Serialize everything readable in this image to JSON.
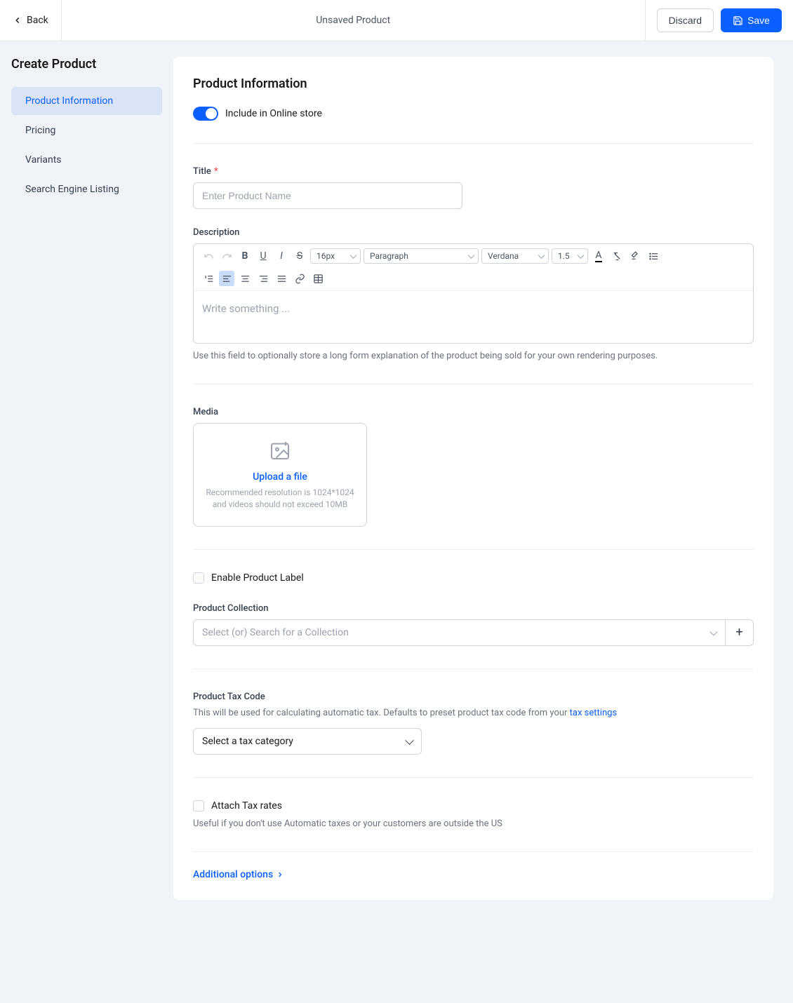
{
  "header": {
    "back": "Back",
    "title": "Unsaved Product",
    "discard": "Discard",
    "save": "Save"
  },
  "sidebar": {
    "title": "Create Product",
    "items": [
      {
        "label": "Product Information"
      },
      {
        "label": "Pricing"
      },
      {
        "label": "Variants"
      },
      {
        "label": "Search Engine Listing"
      }
    ]
  },
  "form": {
    "heading": "Product Information",
    "toggle_label": "Include in Online store",
    "title_label": "Title",
    "title_placeholder": "Enter Product Name",
    "desc_label": "Description",
    "desc_placeholder": "Write something ...",
    "desc_hint": "Use this field to optionally store a long form explanation of the product being sold for your own rendering purposes.",
    "media_label": "Media",
    "upload_text": "Upload a file",
    "upload_hint": "Recommended resolution is 1024*1024 and videos should not exceed 10MB",
    "enable_label_text": "Enable Product Label",
    "collection_label": "Product Collection",
    "collection_placeholder": "Select (or) Search for a Collection",
    "tax_label": "Product Tax Code",
    "tax_hint_prefix": "This will be used for calculating automatic tax. Defaults to preset product tax code from your ",
    "tax_hint_link": "tax settings",
    "tax_placeholder": "Select a tax category",
    "attach_tax_label": "Attach Tax rates",
    "attach_tax_hint": "Useful if you don't use Automatic taxes or your customers are outside the US",
    "additional_options": "Additional options"
  },
  "richtext": {
    "fontsize": "16px",
    "block": "Paragraph",
    "font": "Verdana",
    "lineheight": "1.5"
  }
}
